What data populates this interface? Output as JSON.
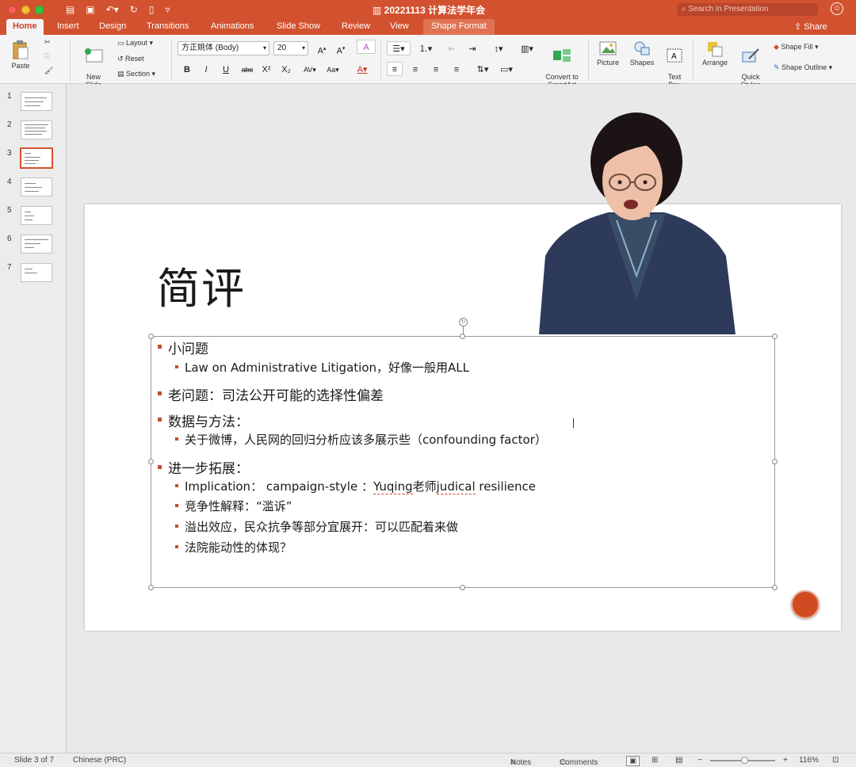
{
  "window": {
    "title": "20221113 计算法学年会",
    "search_placeholder": "Search in Presentation",
    "share_label": "Share"
  },
  "tabs": [
    "Home",
    "Insert",
    "Design",
    "Transitions",
    "Animations",
    "Slide Show",
    "Review",
    "View",
    "Shape Format"
  ],
  "active_tab": "Home",
  "ribbon": {
    "paste": "Paste",
    "new_slide": "New\nSlide",
    "layout": "Layout",
    "reset": "Reset",
    "section": "Section",
    "font_name": "方正姚体 (Body)",
    "font_size": "20",
    "bold": "B",
    "italic": "I",
    "underline": "U",
    "strike": "abc",
    "superscript": "X²",
    "subscript": "X₂",
    "convert_smartart": "Convert to\nSmartArt",
    "picture": "Picture",
    "shapes": "Shapes",
    "text_box": "Text\nBox",
    "arrange": "Arrange",
    "quick_styles": "Quick\nStyles",
    "shape_fill": "Shape Fill",
    "shape_outline": "Shape Outline"
  },
  "thumbnails": [
    "1",
    "2",
    "3",
    "4",
    "5",
    "6",
    "7"
  ],
  "active_slide": 3,
  "slide": {
    "title": "简评",
    "bullets": [
      {
        "level": 1,
        "text": "小问题"
      },
      {
        "level": 2,
        "text": "Law on Administrative Litigation，好像一般用ALL"
      },
      {
        "level": 1,
        "text": "老问题：司法公开可能的选择性偏差"
      },
      {
        "level": 1,
        "text": "数据与方法："
      },
      {
        "level": 2,
        "text": "关于微博，人民网的回归分析应该多展示些（confounding factor）"
      },
      {
        "level": 1,
        "text": "进一步拓展："
      },
      {
        "level": 2,
        "text_parts": [
          "Implication： campaign-style ：",
          "Yuqing",
          "老师",
          "judical",
          " resilience"
        ]
      },
      {
        "level": 2,
        "text": "竞争性解释：“滥诉”"
      },
      {
        "level": 2,
        "text": "溢出效应，民众抗争等部分宜展开：可以匹配着来做"
      },
      {
        "level": 2,
        "text": "法院能动性的体现？"
      }
    ]
  },
  "status_bar": {
    "slide_indicator": "Slide 3 of 7",
    "language": "Chinese (PRC)",
    "notes": "Notes",
    "comments": "Comments",
    "zoom": "116%"
  },
  "colors": {
    "accent": "#d2522f",
    "bullet": "#c0502a"
  }
}
